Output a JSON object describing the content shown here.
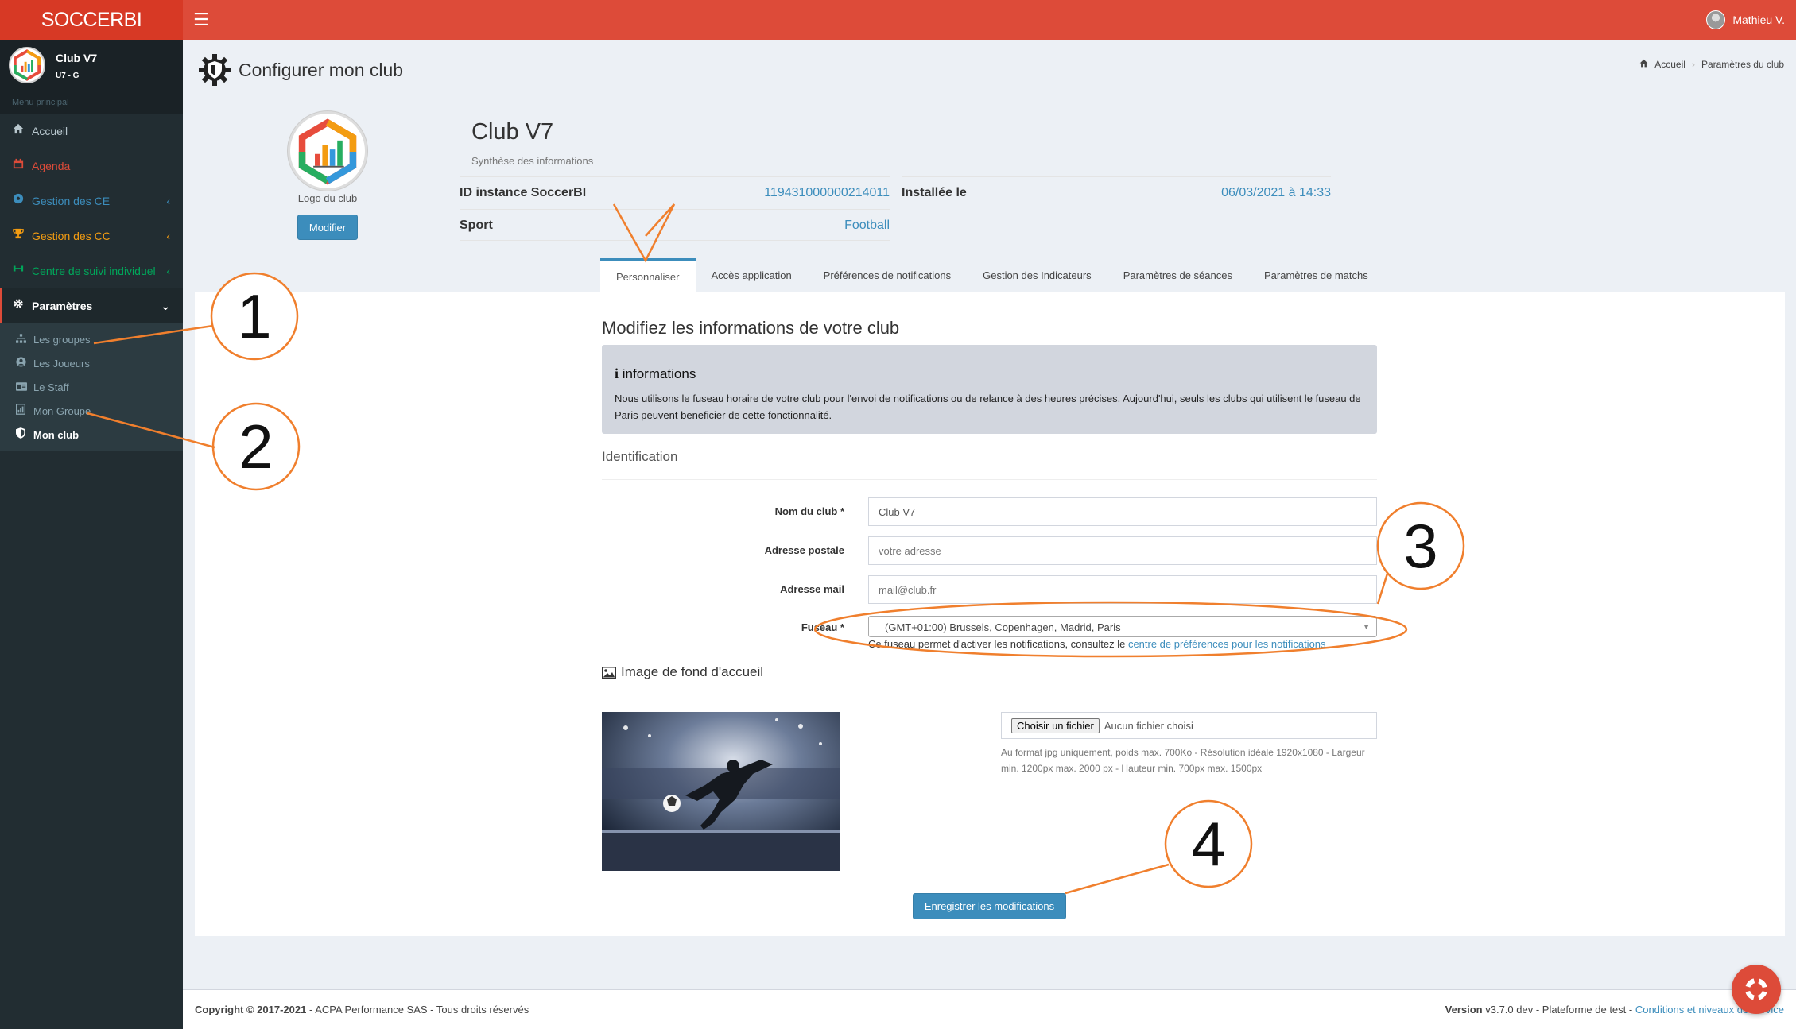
{
  "header": {
    "brand": "SOCCERBI",
    "menu_icon": "☰",
    "user_name": "Mathieu V."
  },
  "sidebar": {
    "club_name": "Club V7",
    "club_team": "U7 - G",
    "menu_header": "Menu principal",
    "items": [
      {
        "label": "Accueil",
        "icon": "home-icon",
        "color": "#b8c7ce"
      },
      {
        "label": "Agenda",
        "icon": "calendar-icon",
        "color": "#dd4b39"
      },
      {
        "label": "Gestion des CE",
        "icon": "soccer-ball-icon",
        "color": "#3c8dbc"
      },
      {
        "label": "Gestion des CC",
        "icon": "trophy-icon",
        "color": "#f39c12"
      },
      {
        "label": "Centre de suivi individuel",
        "icon": "dumbbell-icon",
        "color": "#00a65a"
      },
      {
        "label": "Paramètres",
        "icon": "gear-icon",
        "color": "#ffffff"
      }
    ],
    "submenu": [
      {
        "label": "Les groupes",
        "icon": "sitemap-icon"
      },
      {
        "label": "Les Joueurs",
        "icon": "user-circle-icon"
      },
      {
        "label": "Le Staff",
        "icon": "id-card-icon"
      },
      {
        "label": "Mon Groupe",
        "icon": "chart-file-icon"
      },
      {
        "label": "Mon club",
        "icon": "shield-icon"
      }
    ]
  },
  "page": {
    "title": "Configurer mon club",
    "breadcrumb": {
      "home": "Accueil",
      "current": "Paramètres du club"
    }
  },
  "club_card": {
    "logo_caption": "Logo du club",
    "modify_button": "Modifier",
    "name": "Club V7",
    "subtitle": "Synthèse des informations",
    "fields": [
      {
        "key": "ID instance SoccerBI",
        "value": "119431000000214011"
      },
      {
        "key": "Installée le",
        "value": "06/03/2021 à 14:33"
      },
      {
        "key": "Sport",
        "value": "Football"
      }
    ]
  },
  "tabs": [
    "Personnaliser",
    "Accès application",
    "Préférences de notifications",
    "Gestion des Indicateurs",
    "Paramètres de séances",
    "Paramètres de matchs"
  ],
  "form": {
    "heading": "Modifiez les informations de votre club",
    "callout_icon": "i",
    "callout_title": "informations",
    "callout_text": "Nous utilisons le fuseau horaire de votre club pour l'envoi de notifications ou de relance à des heures précises. Aujourd'hui, seuls les clubs qui utilisent le fuseau de Paris peuvent beneficier de cette fonctionnalité.",
    "section_identification": "Identification",
    "club_name_label": "Nom du club *",
    "club_name_value": "Club V7",
    "address_label": "Adresse postale",
    "address_placeholder": "votre adresse",
    "email_label": "Adresse mail",
    "email_placeholder": "mail@club.fr",
    "timezone_label": "Fuseau *",
    "timezone_value": "(GMT+01:00) Brussels, Copenhagen, Madrid, Paris",
    "timezone_help_prefix": "Ce fuseau permet d'activer les notifications, consultez le ",
    "timezone_help_link": "centre de préférences pour les notifications",
    "section_background": "Image de fond d'accueil",
    "file_button": "Choisir un fichier",
    "file_status": "Aucun fichier choisi",
    "file_help": "Au format jpg uniquement, poids max. 700Ko - Résolution idéale 1920x1080 - Largeur min. 1200px max. 2000 px - Hauteur min. 700px max. 1500px",
    "save_button": "Enregistrer les modifications"
  },
  "footer": {
    "copyright_bold": "Copyright © 2017-2021",
    "copyright_rest": " - ACPA Performance SAS - Tous droits réservés",
    "version_bold": "Version",
    "version_rest": " v3.7.0 dev - Plateforme de test - ",
    "conditions_link": "Conditions et niveaux de service"
  },
  "annotations": [
    "1",
    "2",
    "3",
    "4"
  ],
  "colors": {
    "header_red": "#dd4b39",
    "accent_blue": "#3c8dbc",
    "annotation_orange": "#f07f2d",
    "sidebar_dark": "#222d32"
  }
}
